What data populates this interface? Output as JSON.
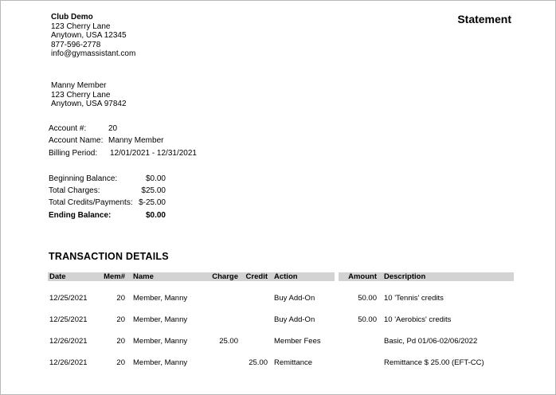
{
  "club": {
    "name": "Club Demo",
    "address1": "123 Cherry Lane",
    "address2": "Anytown, USA 12345",
    "phone": "877-596-2778",
    "email": "info@gymassistant.com"
  },
  "statement_title": "Statement",
  "member": {
    "name": "Manny Member",
    "address1": "123 Cherry Lane",
    "address2": "Anytown, USA 97842"
  },
  "account": {
    "number_label": "Account #:",
    "number": "20",
    "name_label": "Account Name:",
    "name": "Manny Member",
    "period_label": "Billing Period:",
    "period": "12/01/2021 - 12/31/2021"
  },
  "balances": {
    "beginning_label": "Beginning Balance:",
    "beginning": "$0.00",
    "charges_label": "Total Charges:",
    "charges": "$25.00",
    "credits_label": "Total Credits/Payments:",
    "credits": "$-25.00",
    "ending_label": "Ending Balance:",
    "ending": "$0.00"
  },
  "transactions": {
    "title": "TRANSACTION DETAILS",
    "headers": {
      "date": "Date",
      "mem": "Mem#",
      "name": "Name",
      "charge": "Charge",
      "credit": "Credit",
      "action": "Action",
      "amount": "Amount",
      "description": "Description"
    },
    "rows": [
      {
        "date": "12/25/2021",
        "mem": "20",
        "name": "Member, Manny",
        "charge": "",
        "credit": "",
        "action": "Buy Add-On",
        "amount": "50.00",
        "description": "10 'Tennis' credits"
      },
      {
        "date": "12/25/2021",
        "mem": "20",
        "name": "Member, Manny",
        "charge": "",
        "credit": "",
        "action": "Buy Add-On",
        "amount": "50.00",
        "description": "10 'Aerobics' credits"
      },
      {
        "date": "12/26/2021",
        "mem": "20",
        "name": "Member, Manny",
        "charge": "25.00",
        "credit": "",
        "action": "Member Fees",
        "amount": "",
        "description": "Basic, Pd 01/06-02/06/2022"
      },
      {
        "date": "12/26/2021",
        "mem": "20",
        "name": "Member, Manny",
        "charge": "",
        "credit": "25.00",
        "action": "Remittance",
        "amount": "",
        "description": "Remittance $ 25.00 (EFT-CC)"
      }
    ]
  }
}
